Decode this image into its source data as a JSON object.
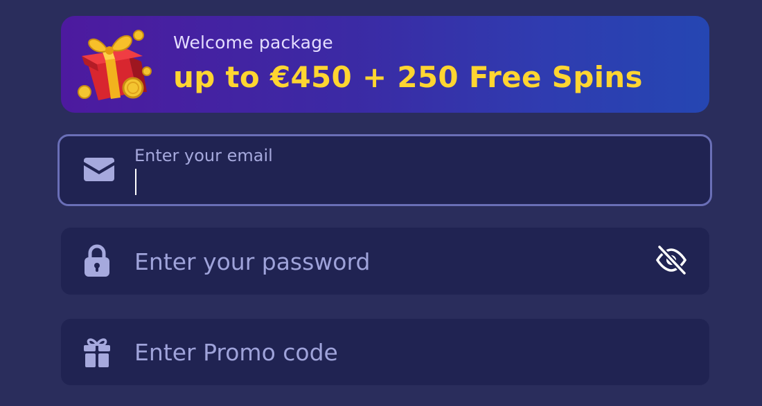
{
  "banner": {
    "subtitle": "Welcome package",
    "headline": "up to €450 + 250 Free Spins",
    "art_icon": "gift-box-with-coins"
  },
  "email_field": {
    "label": "Enter your email",
    "value": "",
    "icon": "envelope-icon"
  },
  "password_field": {
    "placeholder": "Enter your password",
    "value": "",
    "icon": "lock-icon",
    "toggle_icon": "eye-off-icon"
  },
  "promo_field": {
    "placeholder": "Enter Promo code",
    "value": "",
    "icon": "gift-icon"
  },
  "colors": {
    "background": "#2a2d5c",
    "field_background": "#202352",
    "focus_border": "#6a6fb7",
    "headline": "#ffd531",
    "placeholder": "#9fa3da",
    "icon": "#a6a9dd"
  }
}
